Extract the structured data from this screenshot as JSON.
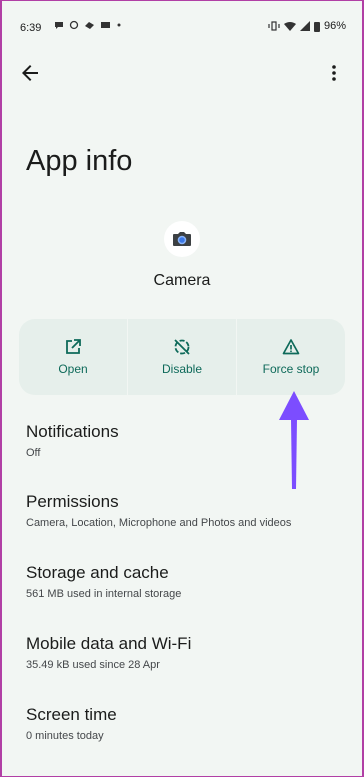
{
  "status_bar": {
    "time": "6:39",
    "battery": "96%"
  },
  "page": {
    "title": "App info"
  },
  "app": {
    "name": "Camera"
  },
  "actions": [
    {
      "label": "Open",
      "icon": "open-external-icon"
    },
    {
      "label": "Disable",
      "icon": "disable-icon"
    },
    {
      "label": "Force stop",
      "icon": "warning-icon"
    }
  ],
  "settings": [
    {
      "title": "Notifications",
      "subtitle": "Off"
    },
    {
      "title": "Permissions",
      "subtitle": "Camera, Location, Microphone and Photos and videos"
    },
    {
      "title": "Storage and cache",
      "subtitle": "561 MB used in internal storage"
    },
    {
      "title": "Mobile data and Wi-Fi",
      "subtitle": "35.49 kB used since 28 Apr"
    },
    {
      "title": "Screen time",
      "subtitle": "0 minutes today"
    }
  ],
  "colors": {
    "accent": "#0e6a5a",
    "annotation_arrow": "#7c4dff",
    "frame_border": "#b13fa5"
  }
}
